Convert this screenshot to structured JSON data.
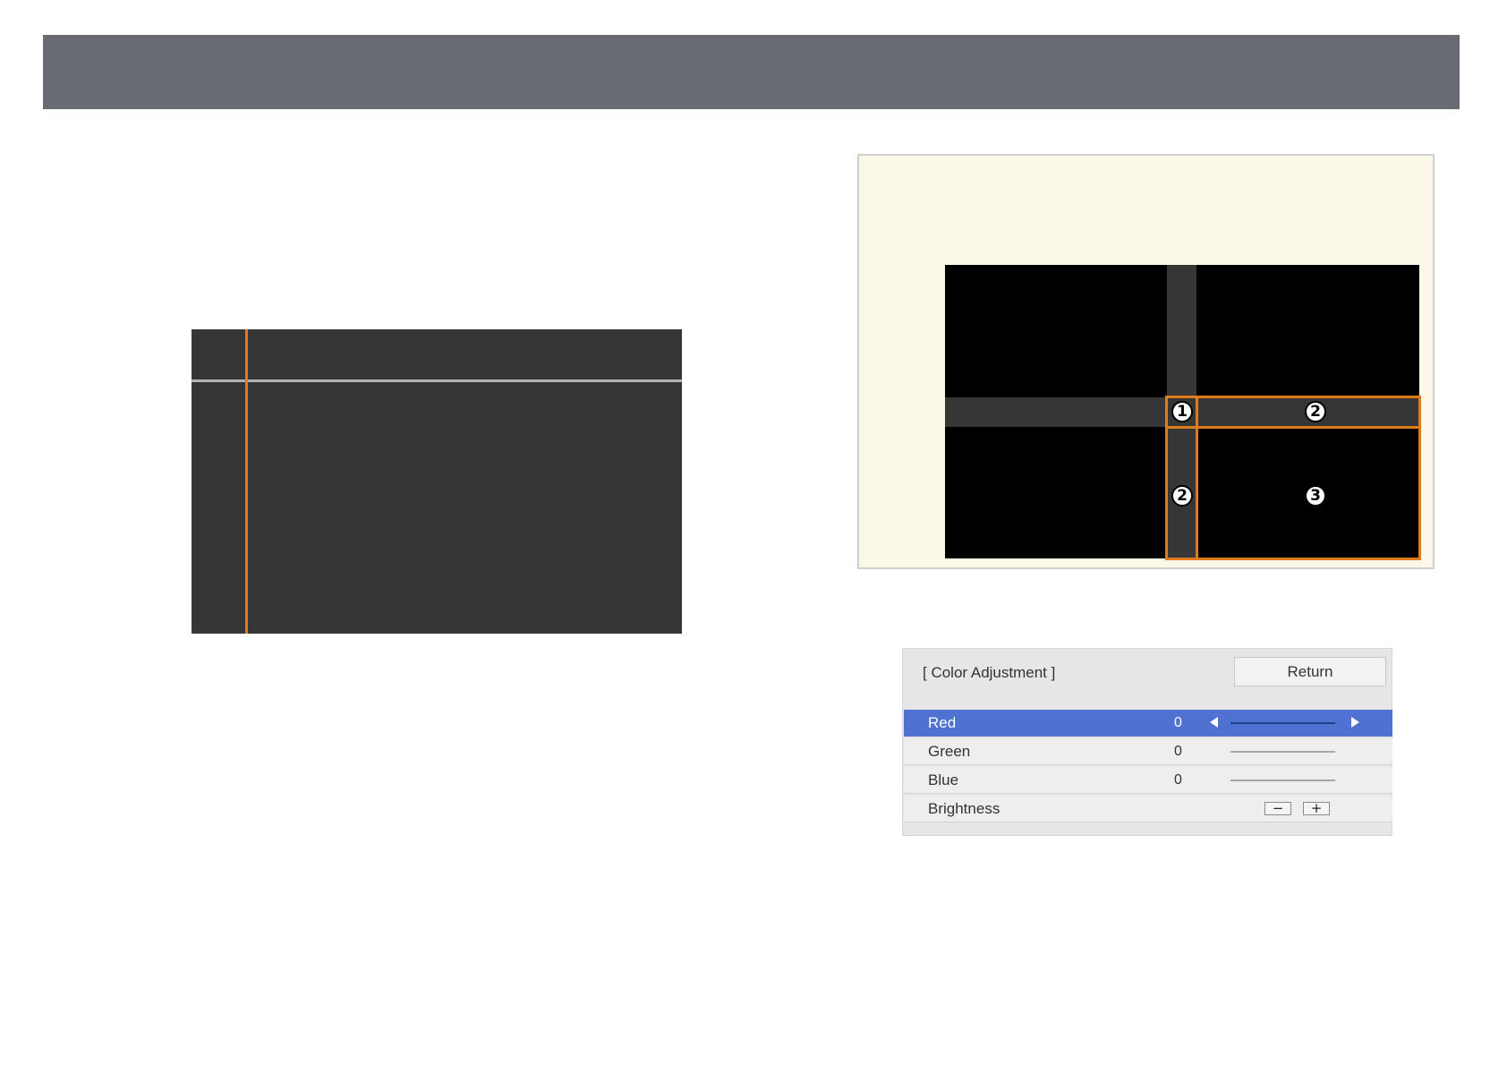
{
  "colors": {
    "header": "#686b73",
    "accent_orange": "#e07b1c",
    "selection_blue": "#4f71d2",
    "panel_cream": "#fcf8e7"
  },
  "diagram": {
    "callouts": {
      "one": "1",
      "two_top": "2",
      "two_left": "2",
      "three": "3"
    }
  },
  "color_adjustment": {
    "title": "[ Color Adjustment ]",
    "return_label": "Return",
    "rows": [
      {
        "label": "Red",
        "value": "0",
        "selected": true
      },
      {
        "label": "Green",
        "value": "0"
      },
      {
        "label": "Blue",
        "value": "0"
      },
      {
        "label": "Brightness",
        "value": ""
      }
    ],
    "minus_label": "−",
    "plus_label": "+",
    "icons": [
      "arrow-left-icon",
      "arrow-right-icon"
    ]
  }
}
